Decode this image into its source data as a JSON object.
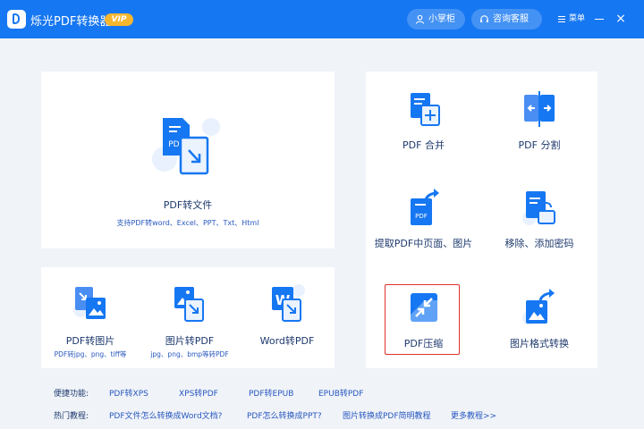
{
  "app": {
    "title": "烁光PDF转换器",
    "vip": "VIP"
  },
  "header": {
    "user_label": "小掌柜",
    "support_label": "咨询客服",
    "menu_label": "菜单",
    "close_glyph": "×"
  },
  "main_tool": {
    "label": "PDF转文件",
    "subtitle": "支持PDF转word、Excel、PPT、Txt、Html",
    "icon_text": "PDF"
  },
  "left_tools": [
    {
      "label": "PDF转图片",
      "subtitle": "PDF转jpg、png、tiff等",
      "icon": "pdf-to-image-icon"
    },
    {
      "label": "图片转PDF",
      "subtitle": "jpg、png、bmp等转PDF",
      "icon": "image-to-pdf-icon"
    },
    {
      "label": "Word转PDF",
      "subtitle": "",
      "icon": "word-to-pdf-icon",
      "icon_text": "W"
    }
  ],
  "right_tools": [
    {
      "label": "PDF 合并",
      "icon": "merge-pdf-icon"
    },
    {
      "label": "PDF 分割",
      "icon": "split-pdf-icon"
    },
    {
      "label": "提取PDF中页面、图片",
      "icon": "extract-pdf-icon",
      "icon_text": "PDF"
    },
    {
      "label": "移除、添加密码",
      "icon": "password-lock-icon"
    },
    {
      "label": "PDF压缩",
      "icon": "compress-pdf-icon",
      "selected": true
    },
    {
      "label": "图片格式转换",
      "icon": "image-format-convert-icon"
    }
  ],
  "shortcuts": {
    "label": "便捷功能:",
    "links": [
      "PDF转XPS",
      "XPS转PDF",
      "PDF转EPUB",
      "EPUB转PDF"
    ]
  },
  "tutorials": {
    "label": "热门教程:",
    "links": [
      "PDF文件怎么转换成Word文档?",
      "PDF怎么转换成PPT?",
      "图片转换成PDF简明教程",
      "更多教程>>"
    ]
  },
  "colors": {
    "brand": "#1677f2",
    "vip": "#f6b62e",
    "highlight": "#e0312b",
    "link": "#2858c0"
  }
}
